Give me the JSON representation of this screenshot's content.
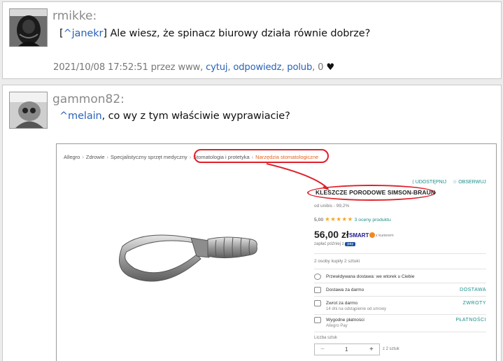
{
  "comments": [
    {
      "author": "rmikke:",
      "reply_to": "^janekr",
      "text": " Ale wiesz, że spinacz biurowy działa równie dobrze?",
      "date": "2021/10/08 17:52:51 przez www,",
      "actions": {
        "cytuj": "cytuj",
        "odpowiedz": "odpowiedz",
        "polub": "polub"
      },
      "likes": "0",
      "heart": "♥"
    },
    {
      "author": "gammon82:",
      "reply_to": "^melain",
      "text": ", co wy z tym właściwie wyprawiacie?"
    }
  ],
  "embedded": {
    "breadcrumbs": [
      "Allegro",
      "Zdrowie",
      "Specjalistyczny sprzęt medyczny",
      "Stomatologia i protetyka",
      "Narzędzia stomatologiczne"
    ],
    "share": "UDOSTĘPNIJ",
    "follow": "OBSERWUJ",
    "title": "KLESZCZE PORODOWE SIMSON-BRAUN",
    "seller": "od unibis - 99,2%",
    "rating_value": "5,00",
    "stars": "★★★★★",
    "rating_count": "3 oceny produktu",
    "price": "56,00 zł",
    "smart": "SMART",
    "smart_sub": "z kurierem",
    "pay_later": "zapłać później z",
    "pay_badge": "pay",
    "bought": "2 osoby kupiły 2 sztuki",
    "delivery": {
      "label": "Przewidywana dostawa: we wtorek u Ciebie"
    },
    "free_delivery": {
      "label": "Dostawa za darmo",
      "right": "DOSTAWA"
    },
    "returns": {
      "label": "Zwrot za darmo",
      "sub": "14 dni na odstąpienie od umowy",
      "right": "ZWROTY"
    },
    "payments": {
      "label": "Wygodne płatności",
      "sub": "Allegro Pay",
      "right": "PŁATNOŚCI"
    },
    "qty_label": "Liczba sztuk",
    "qty_value": "1",
    "qty_minus": "−",
    "qty_plus": "+",
    "qty_of": "z 2 sztuk"
  },
  "colors": {
    "link": "#2a62b8",
    "accent_orange": "#e3621f",
    "highlight_red": "#e0202a",
    "teal": "#1b8e8a"
  }
}
